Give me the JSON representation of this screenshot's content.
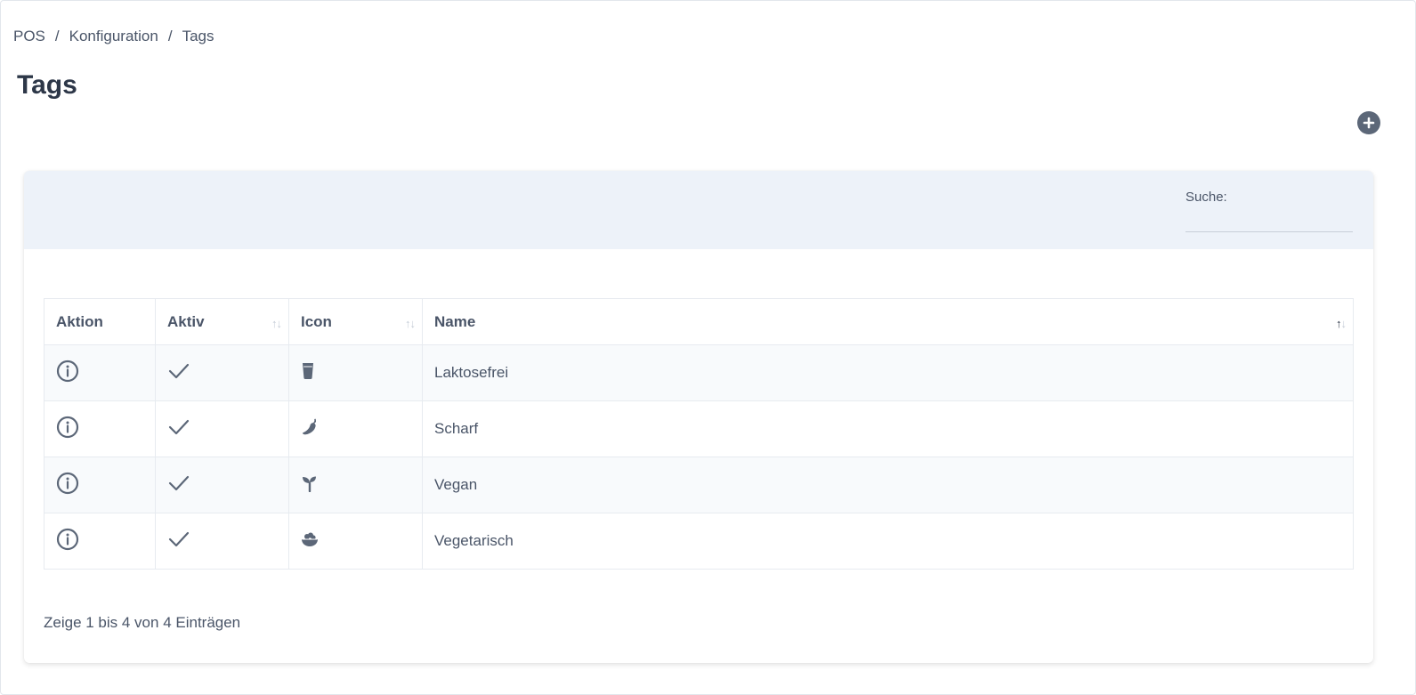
{
  "breadcrumb": {
    "items": [
      "POS",
      "Konfiguration",
      "Tags"
    ],
    "separator": "/"
  },
  "page": {
    "title": "Tags"
  },
  "search": {
    "label": "Suche:",
    "value": "",
    "placeholder": ""
  },
  "table": {
    "columns": [
      "Aktion",
      "Aktiv",
      "Icon",
      "Name"
    ],
    "rows": [
      {
        "action_icon": "info-icon",
        "active": true,
        "icon": "glass-icon",
        "name": "Laktosefrei"
      },
      {
        "action_icon": "info-icon",
        "active": true,
        "icon": "pepper-icon",
        "name": "Scharf"
      },
      {
        "action_icon": "info-icon",
        "active": true,
        "icon": "seedling-icon",
        "name": "Vegan"
      },
      {
        "action_icon": "info-icon",
        "active": true,
        "icon": "salad-bowl-icon",
        "name": "Vegetarisch"
      }
    ]
  },
  "footer": {
    "info": "Zeige 1 bis 4 von 4 Einträgen"
  },
  "colors": {
    "header_bg": "#edf2f9",
    "icon": "#5c6778",
    "text": "#4a5568",
    "title": "#2d3748"
  }
}
